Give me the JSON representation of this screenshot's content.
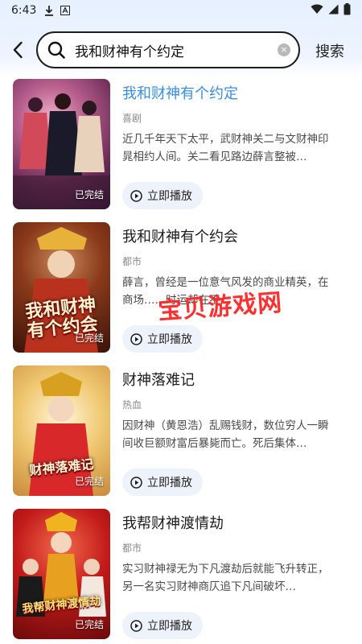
{
  "status_bar": {
    "time": "6:43",
    "icons": [
      "download-icon",
      "font-icon",
      "wifi-icon",
      "signal-icon",
      "battery-icon"
    ]
  },
  "search": {
    "value": "我和财神有个约定",
    "button_label": "搜索",
    "clear_symbol": "×"
  },
  "results": [
    {
      "title": "我和财神有个约定",
      "genre": "喜剧",
      "description": "近几千年天下太平，武财神关二与文财神印晁相约人间。关二看见路边薛言整被…",
      "status": "已完结",
      "play_label": "立即播放",
      "highlighted": true
    },
    {
      "title": "我和财神有个约会",
      "genre": "都市",
      "description": "薛言，曾经是一位意气风发的商业精英，在商场……时运却在不…",
      "status": "已完结",
      "play_label": "立即播放",
      "poster_title": "我和财神有个约会"
    },
    {
      "title": "财神落难记",
      "genre": "热血",
      "description": "因财神（黄恩浩）乱赐钱财，数位穷人一瞬间收巨额财富后暴毙而亡。死后集体…",
      "status": "已完结",
      "play_label": "立即播放",
      "poster_title": "财神落难记"
    },
    {
      "title": "我帮财神渡情劫",
      "genre": "都市",
      "description": "实习财神禄无为下凡渡劫后就能飞升转正，另一名实习财神商仄追下凡间破坏…",
      "status": "已完结",
      "play_label": "立即播放",
      "poster_title": "我帮财神渡情劫"
    }
  ],
  "watermark": "宝贝游戏网",
  "colors": {
    "accent_title": "#3a8de6",
    "watermark": "#ff1f1f",
    "play_button_bg": "#eef2fa"
  }
}
